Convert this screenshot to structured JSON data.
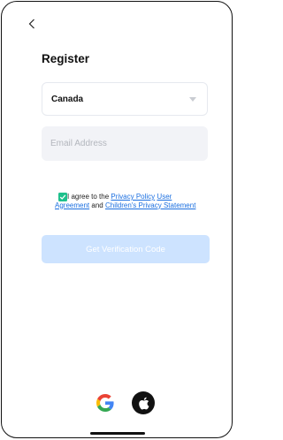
{
  "header": {
    "title": "Register"
  },
  "country": {
    "selected": "Canada"
  },
  "email": {
    "placeholder": "Email Address",
    "value": ""
  },
  "agreement": {
    "checked": true,
    "prefix": "I agree to the",
    "privacy_policy": "Privacy Policy",
    "user_agreement": "User Agreement",
    "conjunction": "and",
    "children_privacy": "Children's Privacy Statement"
  },
  "verify_button": {
    "label": "Get Verification Code"
  },
  "colors": {
    "accent_link": "#1b6fe0",
    "checkbox": "#1fc08c",
    "button_disabled": "#cde3ff",
    "input_background": "#f2f3f7"
  },
  "social_login": [
    {
      "icon": "google-icon"
    },
    {
      "icon": "apple-icon"
    }
  ]
}
